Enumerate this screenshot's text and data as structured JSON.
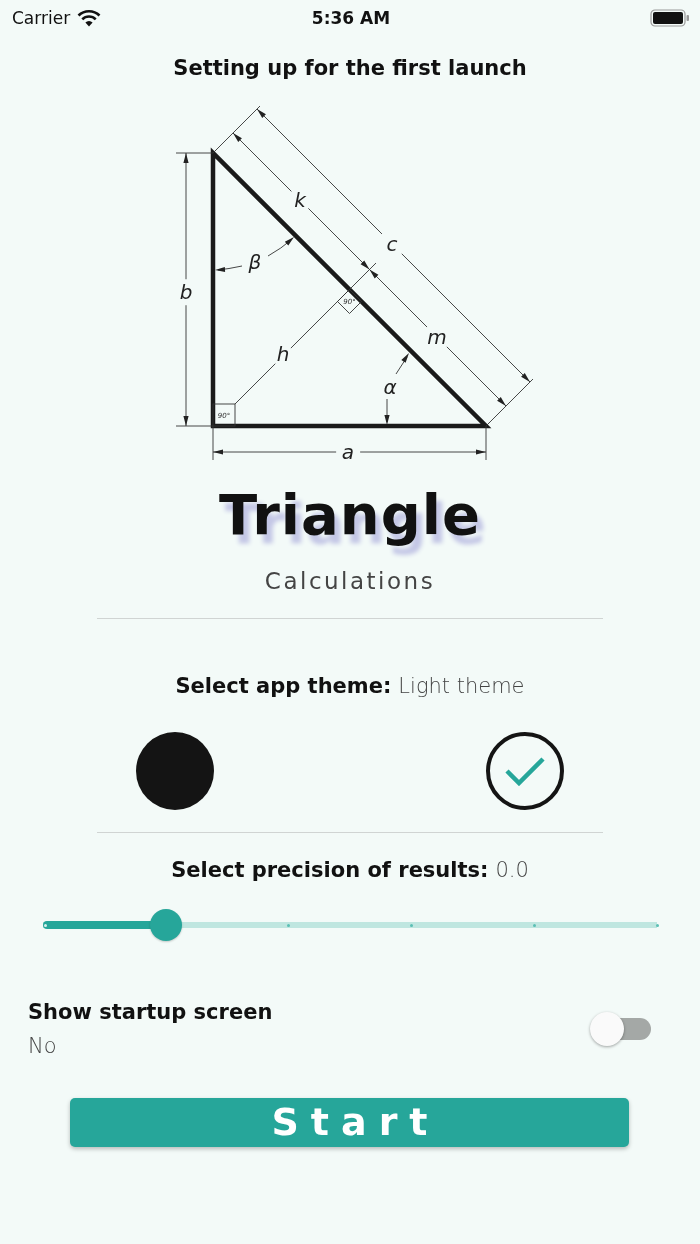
{
  "status_bar": {
    "carrier": "Carrier",
    "time": "5:36 AM"
  },
  "title": "Setting up for the first launch",
  "diagram": {
    "labels": [
      "k",
      "c",
      "b",
      "β",
      "h",
      "m",
      "α",
      "a"
    ],
    "right_angle_labels": [
      "90°",
      "90°"
    ]
  },
  "app_name": {
    "title": "Triangle",
    "subtitle": "Calculations"
  },
  "theme": {
    "label": "Select app theme:",
    "value": "Light theme",
    "options": [
      {
        "kind": "dark",
        "selected": false
      },
      {
        "kind": "light",
        "selected": true
      }
    ]
  },
  "precision": {
    "label": "Select precision of results:",
    "value": "0.0",
    "level": 0.2
  },
  "startup": {
    "label": "Show startup screen",
    "value": "No",
    "on": false
  },
  "start_button": "Start"
}
